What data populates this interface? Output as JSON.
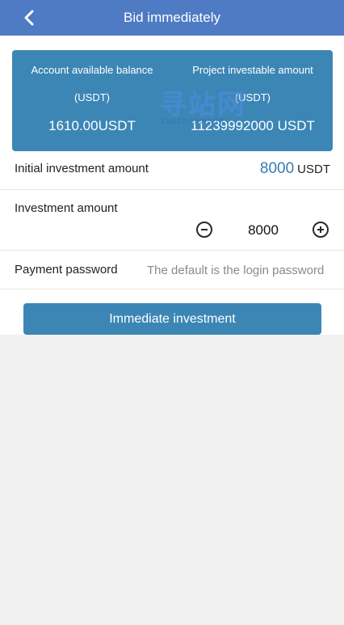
{
  "header": {
    "title": "Bid immediately",
    "back_icon": "chevron-left-icon"
  },
  "card": {
    "left": {
      "label": "Account available balance",
      "unit": "(USDT)",
      "value": "1610.00USDT"
    },
    "right": {
      "label": "Project investable amount",
      "unit": "(USDT)",
      "value": "11239992000 USDT"
    },
    "watermark": {
      "text": "寻站网",
      "subtext": "xunzhanwang"
    }
  },
  "initial_investment": {
    "label": "Initial investment amount",
    "value": "8000",
    "unit": "USDT"
  },
  "investment_amount": {
    "label": "Investment amount",
    "value": "8000",
    "minus_icon": "minus-circle-icon",
    "plus_icon": "plus-circle-icon"
  },
  "payment_password": {
    "label": "Payment password",
    "placeholder": "The default is the login password"
  },
  "submit_label": "Immediate investment",
  "colors": {
    "header_bg": "#4e7bc4",
    "card_bg": "#3c86b5",
    "button_bg": "#3c86b5",
    "accent_value": "#3c7bb2",
    "page_bg": "#f1f1f1"
  }
}
